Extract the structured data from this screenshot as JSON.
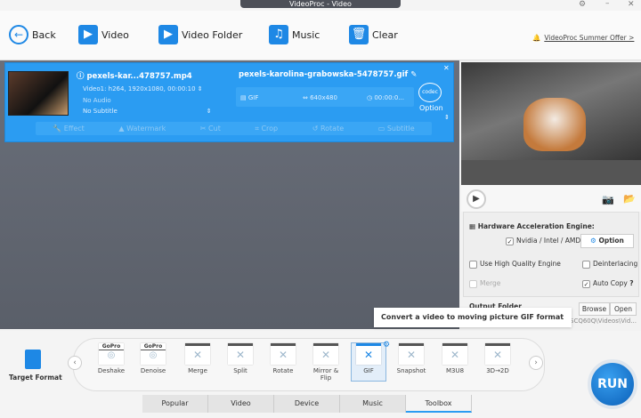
{
  "window": {
    "title": "VideoProc - Video"
  },
  "toolbar": {
    "back": "Back",
    "video": "Video",
    "video_folder": "Video Folder",
    "music": "Music",
    "clear": "Clear",
    "offer": "VideoProc Summer Offer >"
  },
  "item": {
    "source_name": "pexels-kar...478757.mp4",
    "video_track": "Video1: h264, 1920x1080, 00:00:10",
    "audio": "No Audio",
    "subtitle": "No Subtitle",
    "output_name": "pexels-karolina-grabowska-5478757.gif",
    "format": "GIF",
    "resolution": "640x480",
    "duration": "00:00:0...",
    "option": "Option",
    "codec": "codec"
  },
  "edit": {
    "effect": "Effect",
    "watermark": "Watermark",
    "cut": "Cut",
    "crop": "Crop",
    "rotate": "Rotate",
    "subtitle": "Subtitle"
  },
  "settings": {
    "hw_title": "Hardware Acceleration Engine:",
    "hw_vendor": "Nvidia / Intel / AMD",
    "hw_vendor_checked": true,
    "option": "Option",
    "high_quality": "Use High Quality Engine",
    "high_quality_checked": false,
    "deinterlacing": "Deinterlacing",
    "deinterlacing_checked": false,
    "merge": "Merge",
    "merge_checked": false,
    "auto_copy": "Auto Copy",
    "auto_copy_checked": true,
    "help": "?"
  },
  "output": {
    "label": "Output Folder",
    "browse": "Browse",
    "open": "Open",
    "path": "SCQ60Q\\Videos\\Vid..."
  },
  "tooltip": "Convert a video to moving picture GIF format",
  "target_format": "Target Format",
  "formats": [
    {
      "label": "Deshake",
      "brand": "GoPro"
    },
    {
      "label": "Denoise",
      "brand": "GoPro"
    },
    {
      "label": "Merge"
    },
    {
      "label": "Split"
    },
    {
      "label": "Rotate"
    },
    {
      "label": "Mirror & Flip"
    },
    {
      "label": "GIF",
      "selected": true
    },
    {
      "label": "Snapshot"
    },
    {
      "label": "M3U8"
    },
    {
      "label": "3D→2D"
    }
  ],
  "tabs": [
    {
      "label": "Popular"
    },
    {
      "label": "Video"
    },
    {
      "label": "Device"
    },
    {
      "label": "Music"
    },
    {
      "label": "Toolbox",
      "active": true
    }
  ],
  "run": "RUN",
  "colors": {
    "accent": "#2b9cf2",
    "card": "#2b9cf2",
    "offer_bell": "#f06a1d"
  }
}
